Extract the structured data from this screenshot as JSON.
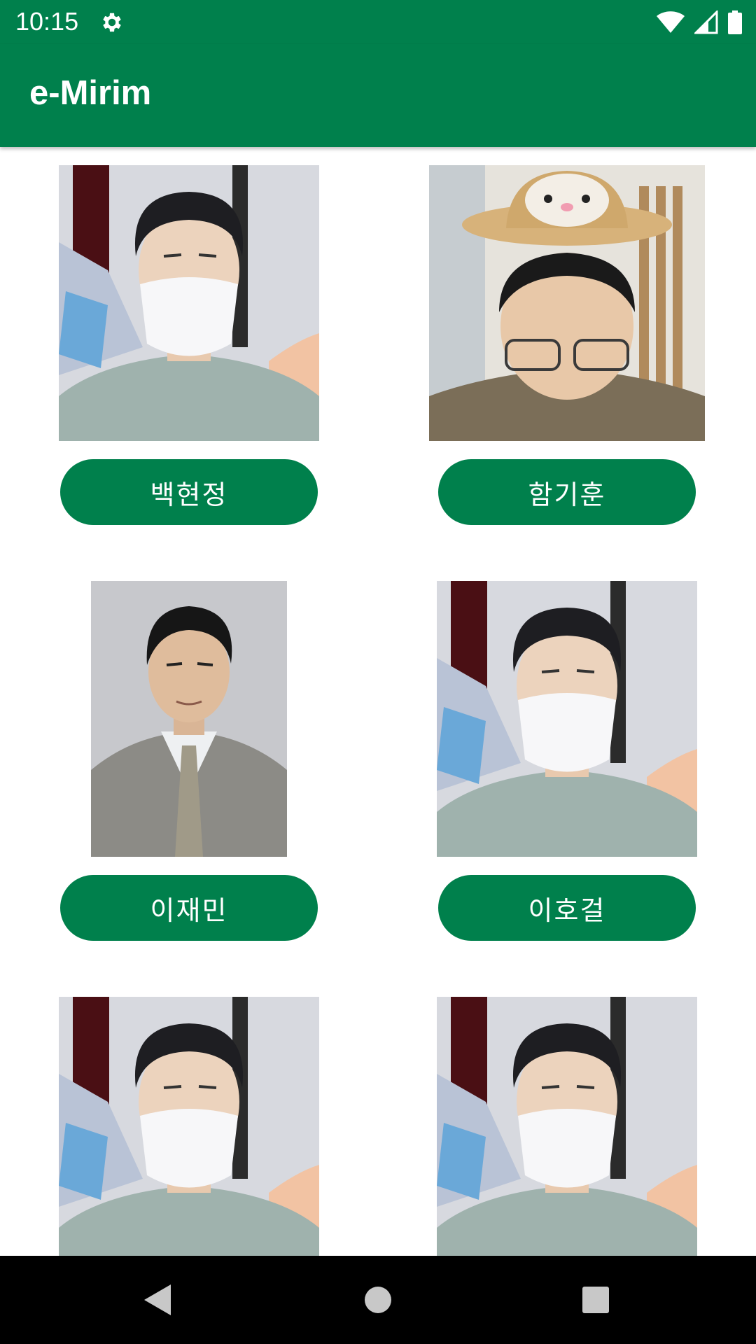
{
  "status_bar": {
    "time": "10:15",
    "icons": [
      "gear-icon",
      "wifi-icon",
      "signal-icon",
      "battery-icon"
    ]
  },
  "app_bar": {
    "title": "e-Mirim"
  },
  "grid": {
    "items": [
      {
        "name": "백현정",
        "photo": "masked-man-photo"
      },
      {
        "name": "함기훈",
        "photo": "man-in-straw-hat-photo"
      },
      {
        "name": "이재민",
        "photo": "man-in-suit-portrait"
      },
      {
        "name": "이호걸",
        "photo": "masked-man-photo"
      },
      {
        "name": "",
        "photo": "masked-man-photo"
      },
      {
        "name": "",
        "photo": "masked-man-photo"
      }
    ]
  },
  "nav_bar": {
    "icons": [
      "back-icon",
      "home-icon",
      "recents-icon"
    ]
  },
  "colors": {
    "primary": "#00804c",
    "background": "#ffffff",
    "nav_bar": "#000000"
  }
}
